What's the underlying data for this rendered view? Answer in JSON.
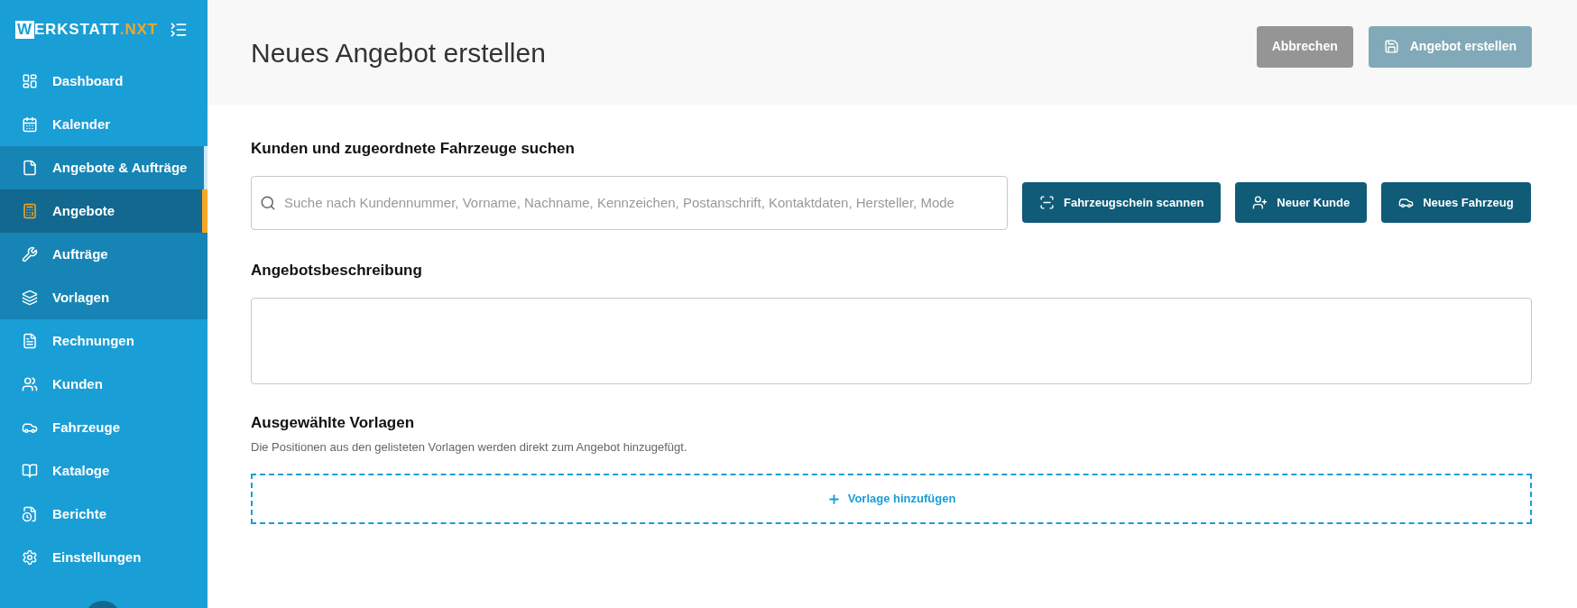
{
  "logo": {
    "boxed": "W",
    "main": "ERKSTATT",
    "accent": ".NXT"
  },
  "sidebar": {
    "items": [
      {
        "label": "Dashboard",
        "selected": false
      },
      {
        "label": "Kalender",
        "selected": false
      },
      {
        "label": "Angebote & Aufträge",
        "selected": false,
        "expanded": true,
        "children": [
          {
            "label": "Angebote",
            "selected": true
          },
          {
            "label": "Aufträge",
            "selected": false
          },
          {
            "label": "Vorlagen",
            "selected": false
          }
        ]
      },
      {
        "label": "Rechnungen",
        "selected": false
      },
      {
        "label": "Kunden",
        "selected": false
      },
      {
        "label": "Fahrzeuge",
        "selected": false
      },
      {
        "label": "Kataloge",
        "selected": false
      },
      {
        "label": "Berichte",
        "selected": false
      },
      {
        "label": "Einstellungen",
        "selected": false
      }
    ]
  },
  "header": {
    "title": "Neues Angebot erstellen",
    "buttons": [
      {
        "label": "Abbrechen",
        "disabled": false
      },
      {
        "label": "Angebot erstellen",
        "disabled": true
      }
    ]
  },
  "customer_search": {
    "heading": "Kunden und zugeordnete Fahrzeuge suchen",
    "placeholder": "Suche nach Kundennummer, Vorname, Nachname, Kennzeichen, Postanschrift, Kontaktdaten, Hersteller, Mode",
    "buttons": [
      "Fahrzeugschein scannen",
      "Neuer Kunde",
      "Neues Fahrzeug"
    ]
  },
  "description": {
    "heading": "Angebotsbeschreibung"
  },
  "templates": {
    "heading": "Ausgewählte Vorlagen",
    "hint": "Die Positionen aus den gelisteten Vorlagen werden direkt zum Angebot hinzugefügt.",
    "add_button": "Vorlage hinzufügen"
  }
}
